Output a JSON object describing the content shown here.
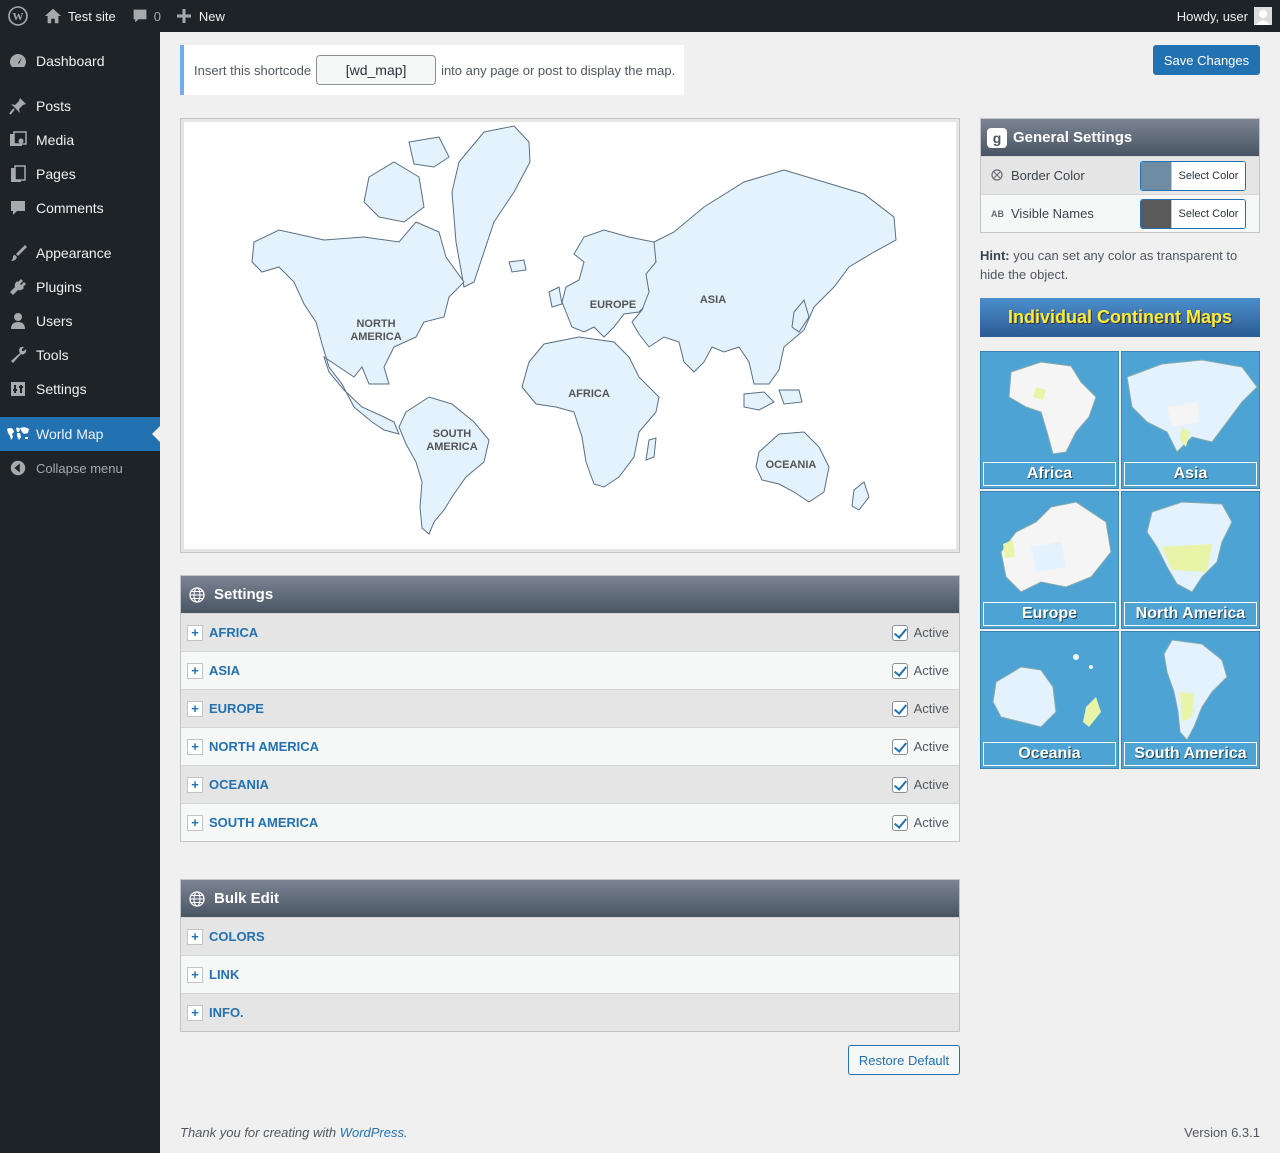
{
  "adminbar": {
    "site_name": "Test site",
    "comments_count": "0",
    "new_label": "New",
    "howdy": "Howdy, user"
  },
  "sidebar": {
    "items": [
      {
        "label": "Dashboard",
        "icon": "dashboard-icon"
      },
      {
        "label": "Posts",
        "icon": "pin-icon"
      },
      {
        "label": "Media",
        "icon": "media-icon"
      },
      {
        "label": "Pages",
        "icon": "pages-icon"
      },
      {
        "label": "Comments",
        "icon": "comment-icon"
      },
      {
        "label": "Appearance",
        "icon": "brush-icon"
      },
      {
        "label": "Plugins",
        "icon": "plug-icon"
      },
      {
        "label": "Users",
        "icon": "user-icon"
      },
      {
        "label": "Tools",
        "icon": "wrench-icon"
      },
      {
        "label": "Settings",
        "icon": "settings-icon"
      },
      {
        "label": "World Map",
        "icon": "world-map-icon"
      }
    ],
    "collapse_label": "Collapse menu"
  },
  "notice": {
    "prefix": "Insert this shortcode",
    "shortcode": "[wd_map]",
    "suffix": "into any page or post to display the map."
  },
  "save_label": "Save Changes",
  "map": {
    "fill_color": "#e3f2fd",
    "border_color": "#5a6f84",
    "labels": {
      "north_america": "NORTH AMERICA",
      "south_america": "SOUTH AMERICA",
      "europe": "EUROPE",
      "africa": "AFRICA",
      "asia": "ASIA",
      "oceania": "OCEANIA"
    }
  },
  "settings_panel": {
    "title": "Settings",
    "active_label": "Active",
    "rows": [
      {
        "label": "AFRICA"
      },
      {
        "label": "ASIA"
      },
      {
        "label": "EUROPE"
      },
      {
        "label": "NORTH AMERICA"
      },
      {
        "label": "OCEANIA"
      },
      {
        "label": "SOUTH AMERICA"
      }
    ]
  },
  "bulk_panel": {
    "title": "Bulk Edit",
    "rows": [
      {
        "label": "COLORS"
      },
      {
        "label": "LINK"
      },
      {
        "label": "INFO."
      }
    ]
  },
  "restore_label": "Restore Default",
  "general_settings": {
    "title": "General Settings",
    "badge": "g",
    "rows": [
      {
        "label": "Border Color",
        "icon": "globe-small-icon",
        "color": "#6e8ca3",
        "button": "Select Color"
      },
      {
        "label": "Visible Names",
        "icon": "ab-icon",
        "icon_text": "AB",
        "color": "#5a5a5a",
        "button": "Select Color"
      }
    ]
  },
  "hint": {
    "bold": "Hint:",
    "text": "you can set any color as transparent to hide the object."
  },
  "continent_maps": {
    "title": "Individual Continent Maps",
    "tiles": [
      "Africa",
      "Asia",
      "Europe",
      "North America",
      "Oceania",
      "South America"
    ]
  },
  "footer": {
    "thanks_prefix": "Thank you for creating with",
    "thanks_link": "WordPress",
    "thanks_suffix": ".",
    "version": "Version 6.3.1"
  }
}
